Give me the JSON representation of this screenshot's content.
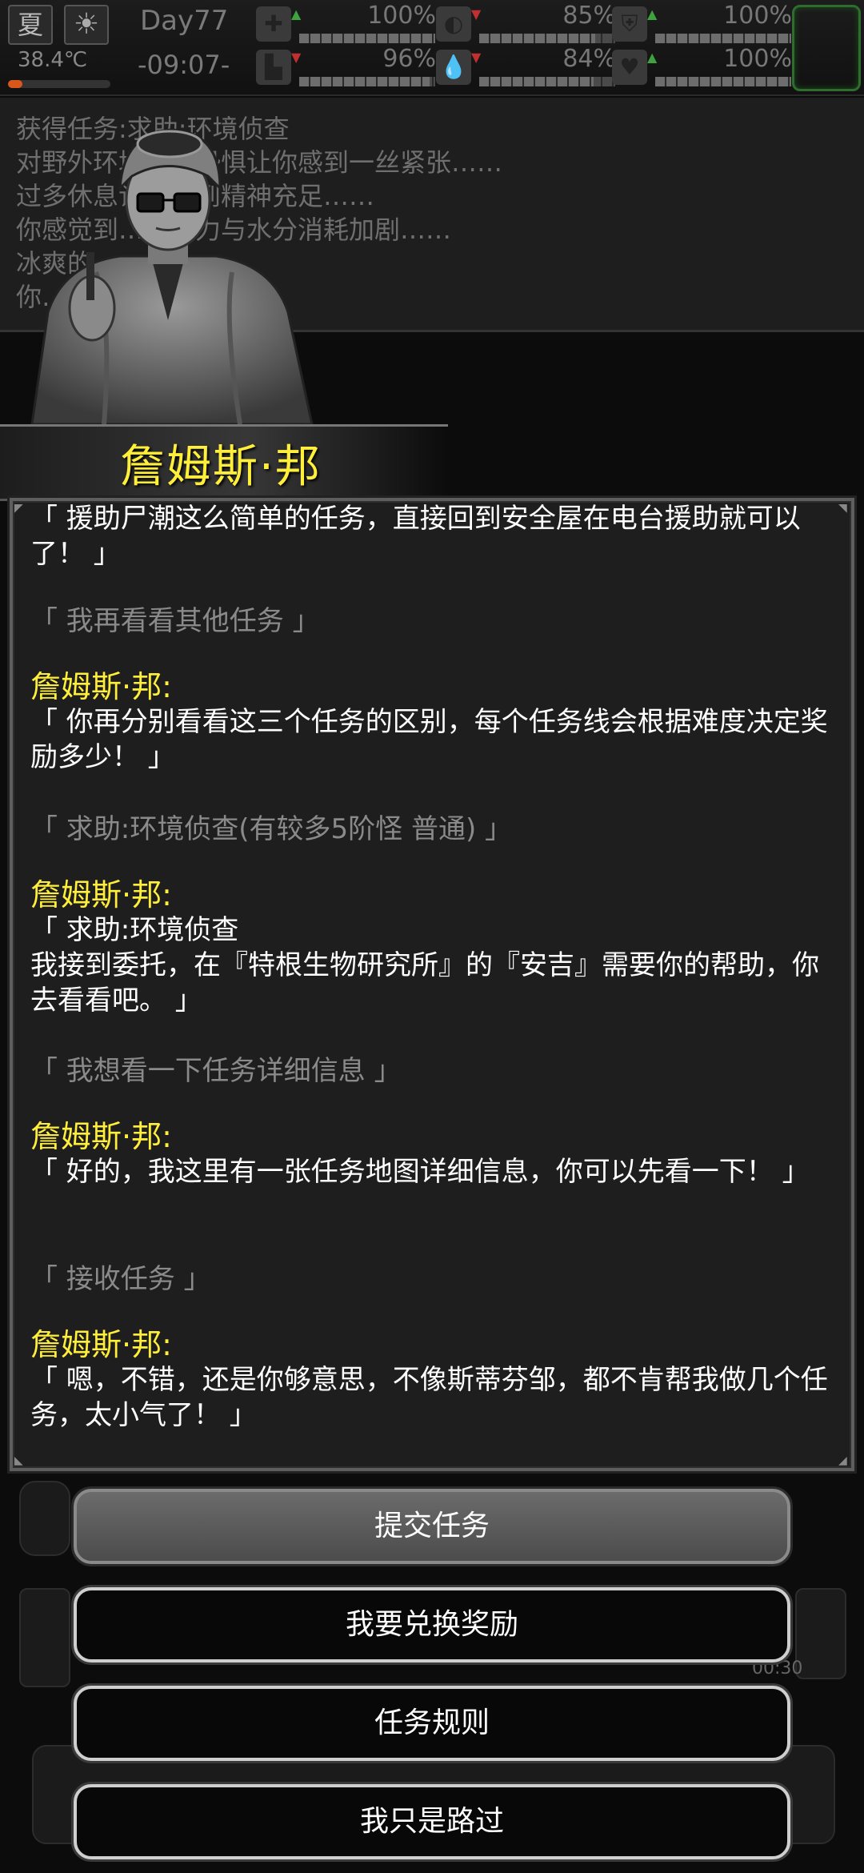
{
  "status": {
    "season": "夏",
    "weather_icon": "sun-icon",
    "temperature": "38.4℃",
    "temperature_level": 0.14,
    "day": "Day77",
    "time": "-09:07-",
    "stats": [
      {
        "name": "health",
        "icon": "medkit-icon",
        "trend": "up",
        "value": "100%",
        "level": 1.0
      },
      {
        "name": "hunger",
        "icon": "stomach-icon",
        "trend": "down",
        "value": "85%",
        "level": 0.85
      },
      {
        "name": "armor",
        "icon": "shield-icon",
        "trend": "up",
        "value": "100%",
        "level": 1.0
      },
      {
        "name": "stamina",
        "icon": "boot-icon",
        "trend": "down",
        "value": "96%",
        "level": 0.96
      },
      {
        "name": "thirst",
        "icon": "water-drop-icon",
        "trend": "down",
        "value": "84%",
        "level": 0.84
      },
      {
        "name": "mood",
        "icon": "heart-icon",
        "trend": "up",
        "value": "100%",
        "level": 1.0
      }
    ]
  },
  "log": [
    "获得任务:求助:环境侦查",
    "对野外环境未知恐惧让你感到一丝紧张……",
    "过多休息让你感到精神充足……",
    "你感觉到……体力与水分消耗加剧……",
    "冰爽的……",
    "你……睡一会儿。"
  ],
  "speaker": {
    "name": "詹姆斯·邦"
  },
  "dialog": [
    {
      "type": "npc",
      "text": "「 援助尸潮这么简单的任务，直接回到安全屋在电台援助就可以了！ 」"
    },
    {
      "type": "player",
      "text": "「 我再看看其他任务 」"
    },
    {
      "type": "speaker",
      "text": "詹姆斯·邦:"
    },
    {
      "type": "npc",
      "text": "「 你再分别看看这三个任务的区别，每个任务线会根据难度决定奖励多少！ 」"
    },
    {
      "type": "player",
      "text": "「 求助:环境侦查(有较多5阶怪  普通) 」"
    },
    {
      "type": "speaker",
      "text": "詹姆斯·邦:"
    },
    {
      "type": "npc",
      "text": "「 求助:环境侦查"
    },
    {
      "type": "npc",
      "text": "我接到委托，在『特根生物研究所』的『安吉』需要你的帮助，你去看看吧。 」"
    },
    {
      "type": "player",
      "text": "「 我想看一下任务详细信息 」"
    },
    {
      "type": "speaker",
      "text": "詹姆斯·邦:"
    },
    {
      "type": "npc",
      "text": "「 好的，我这里有一张任务地图详细信息，你可以先看一下！ 」"
    },
    {
      "type": "player",
      "text": "「 接收任务 」"
    },
    {
      "type": "speaker",
      "text": "詹姆斯·邦:"
    },
    {
      "type": "npc",
      "text": "「 嗯，不错，还是你够意思，不像斯蒂芬邹，都不肯帮我做几个任务，太小气了！ 」"
    }
  ],
  "hud": {
    "timer": "00:30"
  },
  "buttons": [
    {
      "label": "提交任务",
      "style": "primary"
    },
    {
      "label": "我要兑换奖励",
      "style": "dark"
    },
    {
      "label": "任务规则",
      "style": "dark"
    },
    {
      "label": "我只是路过",
      "style": "dark"
    }
  ],
  "colors": {
    "speaker": "#ffef3a",
    "npc_text": "#ffffff",
    "player_text": "#8a8a8a",
    "panel_bg": "#1e1e1e"
  }
}
